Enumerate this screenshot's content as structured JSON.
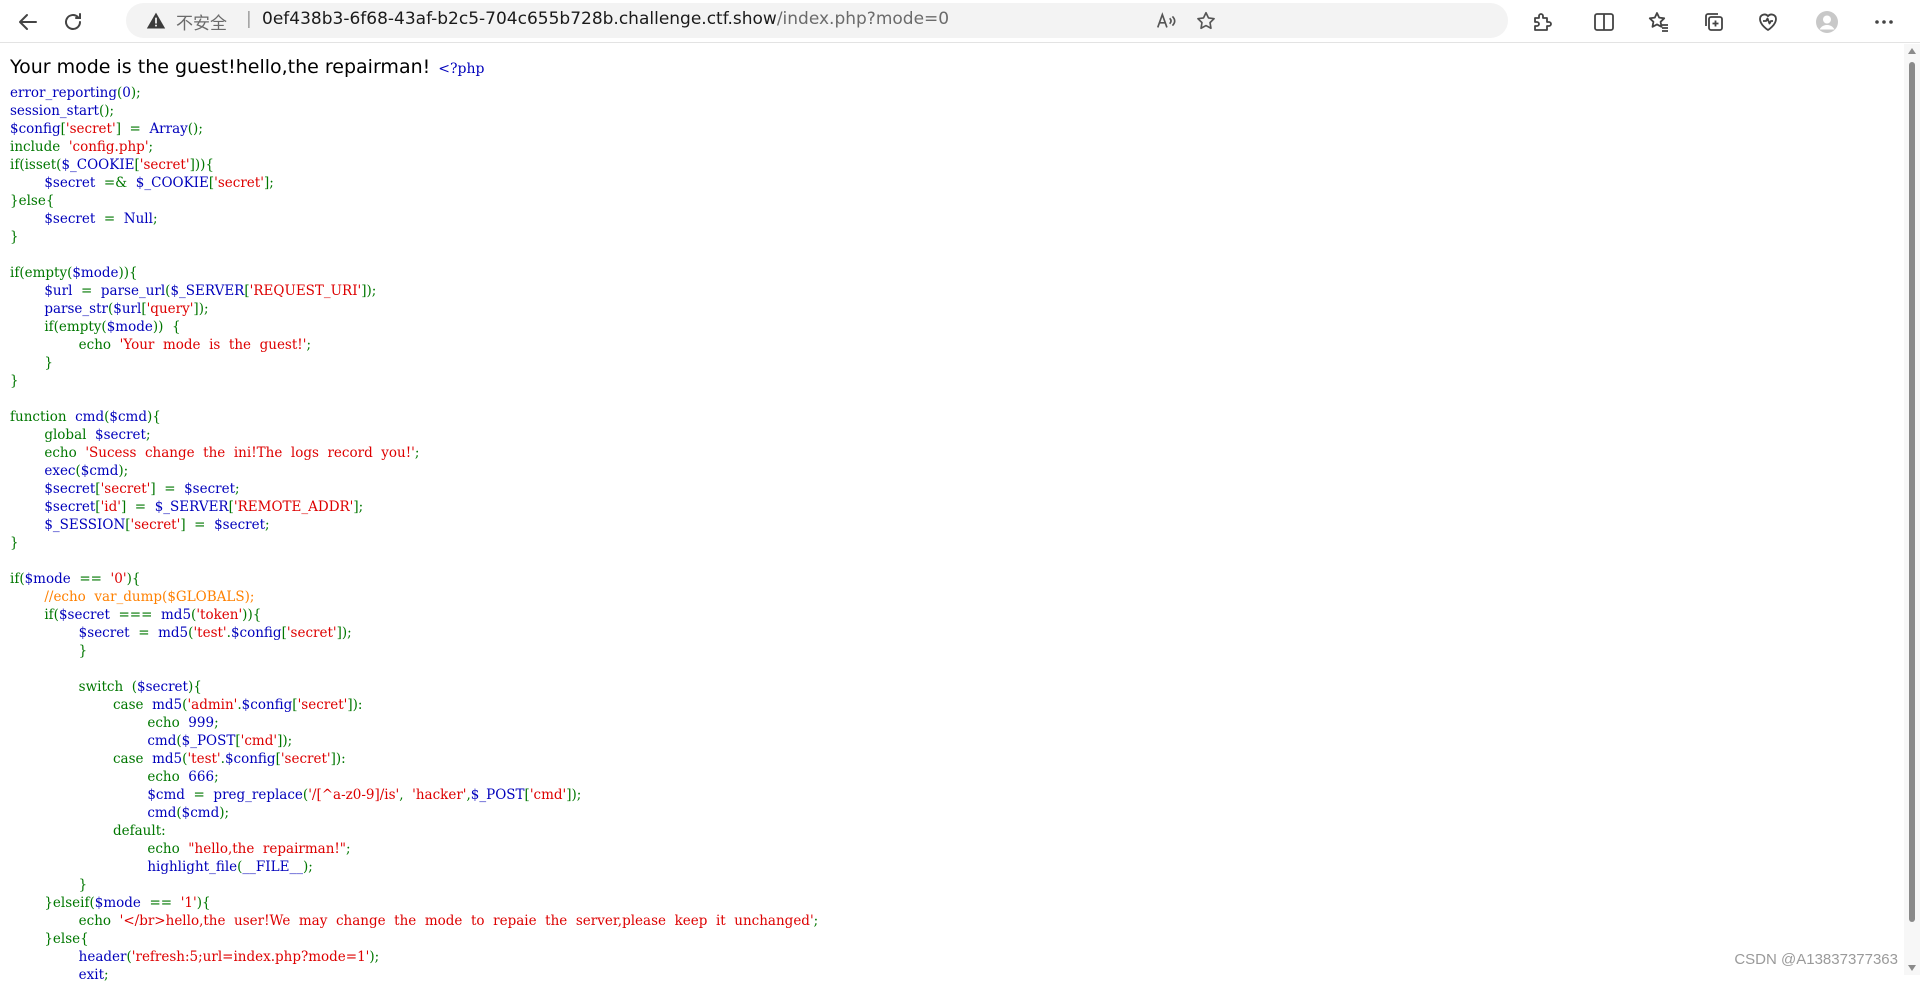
{
  "browser": {
    "security_label": "不安全",
    "separator": "|",
    "url_host": "0ef438b3-6f68-43af-b2c5-704c655b728b.challenge.ctf.show",
    "url_path": "/index.php?mode=0",
    "icons": [
      "back-arrow-icon",
      "reload-icon",
      "warning-icon",
      "read-aloud-icon",
      "favorite-star-icon",
      "extensions-icon",
      "split-screen-icon",
      "favorites-icon",
      "collections-icon",
      "browser-essentials-icon",
      "profile-avatar-icon",
      "more-menu-icon"
    ]
  },
  "page": {
    "greeting": "Your mode is the guest!hello,the repairman!",
    "code_open": "<?php",
    "code_lines": [
      [
        {
          "t": "error_reporting"
        },
        {
          "t": "(",
          "k": "k"
        },
        {
          "t": "0"
        },
        {
          "t": ");",
          "k": "k"
        }
      ],
      [
        {
          "t": "session_start"
        },
        {
          "t": "();",
          "k": "k"
        }
      ],
      [
        {
          "t": "$config"
        },
        {
          "t": "[",
          "k": "k"
        },
        {
          "t": "'secret'",
          "k": "s"
        },
        {
          "t": "]  =  ",
          "k": "k"
        },
        {
          "t": "Array"
        },
        {
          "t": "();",
          "k": "k"
        }
      ],
      [
        {
          "t": "include  ",
          "k": "k"
        },
        {
          "t": "'config.php'",
          "k": "s"
        },
        {
          "t": ";",
          "k": "k"
        }
      ],
      [
        {
          "t": "if(isset(",
          "k": "k"
        },
        {
          "t": "$_COOKIE"
        },
        {
          "t": "[",
          "k": "k"
        },
        {
          "t": "'secret'",
          "k": "s"
        },
        {
          "t": "])){",
          "k": "k"
        }
      ],
      [
        {
          "t": "        "
        },
        {
          "t": "$secret  "
        },
        {
          "t": "=&  ",
          "k": "k"
        },
        {
          "t": "$_COOKIE"
        },
        {
          "t": "[",
          "k": "k"
        },
        {
          "t": "'secret'",
          "k": "s"
        },
        {
          "t": "];",
          "k": "k"
        }
      ],
      [
        {
          "t": "}else{",
          "k": "k"
        }
      ],
      [
        {
          "t": "        "
        },
        {
          "t": "$secret  "
        },
        {
          "t": "=  ",
          "k": "k"
        },
        {
          "t": "Null"
        },
        {
          "t": ";",
          "k": "k"
        }
      ],
      [
        {
          "t": "}",
          "k": "k"
        }
      ],
      [],
      [
        {
          "t": "if(empty(",
          "k": "k"
        },
        {
          "t": "$mode"
        },
        {
          "t": ")){",
          "k": "k"
        }
      ],
      [
        {
          "t": "        "
        },
        {
          "t": "$url  "
        },
        {
          "t": "=  ",
          "k": "k"
        },
        {
          "t": "parse_url"
        },
        {
          "t": "(",
          "k": "k"
        },
        {
          "t": "$_SERVER"
        },
        {
          "t": "[",
          "k": "k"
        },
        {
          "t": "'REQUEST_URI'",
          "k": "s"
        },
        {
          "t": "]);",
          "k": "k"
        }
      ],
      [
        {
          "t": "        "
        },
        {
          "t": "parse_str"
        },
        {
          "t": "(",
          "k": "k"
        },
        {
          "t": "$url"
        },
        {
          "t": "[",
          "k": "k"
        },
        {
          "t": "'query'",
          "k": "s"
        },
        {
          "t": "]);",
          "k": "k"
        }
      ],
      [
        {
          "t": "        "
        },
        {
          "t": "if(empty(",
          "k": "k"
        },
        {
          "t": "$mode"
        },
        {
          "t": "))  {",
          "k": "k"
        }
      ],
      [
        {
          "t": "                "
        },
        {
          "t": "echo  ",
          "k": "k"
        },
        {
          "t": "'Your  mode  is  the  guest!'",
          "k": "s"
        },
        {
          "t": ";",
          "k": "k"
        }
      ],
      [
        {
          "t": "        "
        },
        {
          "t": "}",
          "k": "k"
        }
      ],
      [
        {
          "t": "}",
          "k": "k"
        }
      ],
      [],
      [
        {
          "t": "function  ",
          "k": "k"
        },
        {
          "t": "cmd"
        },
        {
          "t": "(",
          "k": "k"
        },
        {
          "t": "$cmd"
        },
        {
          "t": "){",
          "k": "k"
        }
      ],
      [
        {
          "t": "        "
        },
        {
          "t": "global  ",
          "k": "k"
        },
        {
          "t": "$secret"
        },
        {
          "t": ";",
          "k": "k"
        }
      ],
      [
        {
          "t": "        "
        },
        {
          "t": "echo  ",
          "k": "k"
        },
        {
          "t": "'Sucess  change  the  ini!The  logs  record  you!'",
          "k": "s"
        },
        {
          "t": ";",
          "k": "k"
        }
      ],
      [
        {
          "t": "        "
        },
        {
          "t": "exec"
        },
        {
          "t": "(",
          "k": "k"
        },
        {
          "t": "$cmd"
        },
        {
          "t": ");",
          "k": "k"
        }
      ],
      [
        {
          "t": "        "
        },
        {
          "t": "$secret"
        },
        {
          "t": "[",
          "k": "k"
        },
        {
          "t": "'secret'",
          "k": "s"
        },
        {
          "t": "]  =  ",
          "k": "k"
        },
        {
          "t": "$secret"
        },
        {
          "t": ";",
          "k": "k"
        }
      ],
      [
        {
          "t": "        "
        },
        {
          "t": "$secret"
        },
        {
          "t": "[",
          "k": "k"
        },
        {
          "t": "'id'",
          "k": "s"
        },
        {
          "t": "]  =  ",
          "k": "k"
        },
        {
          "t": "$_SERVER"
        },
        {
          "t": "[",
          "k": "k"
        },
        {
          "t": "'REMOTE_ADDR'",
          "k": "s"
        },
        {
          "t": "];",
          "k": "k"
        }
      ],
      [
        {
          "t": "        "
        },
        {
          "t": "$_SESSION"
        },
        {
          "t": "[",
          "k": "k"
        },
        {
          "t": "'secret'",
          "k": "s"
        },
        {
          "t": "]  =  ",
          "k": "k"
        },
        {
          "t": "$secret"
        },
        {
          "t": ";",
          "k": "k"
        }
      ],
      [
        {
          "t": "}",
          "k": "k"
        }
      ],
      [],
      [
        {
          "t": "if(",
          "k": "k"
        },
        {
          "t": "$mode  "
        },
        {
          "t": "==  ",
          "k": "k"
        },
        {
          "t": "'0'",
          "k": "s"
        },
        {
          "t": "){",
          "k": "k"
        }
      ],
      [
        {
          "t": "        "
        },
        {
          "t": "//echo  var_dump($GLOBALS);",
          "k": "c"
        }
      ],
      [
        {
          "t": "        "
        },
        {
          "t": "if(",
          "k": "k"
        },
        {
          "t": "$secret  "
        },
        {
          "t": "===  ",
          "k": "k"
        },
        {
          "t": "md5"
        },
        {
          "t": "(",
          "k": "k"
        },
        {
          "t": "'token'",
          "k": "s"
        },
        {
          "t": ")){",
          "k": "k"
        }
      ],
      [
        {
          "t": "                "
        },
        {
          "t": "$secret  "
        },
        {
          "t": "=  ",
          "k": "k"
        },
        {
          "t": "md5"
        },
        {
          "t": "(",
          "k": "k"
        },
        {
          "t": "'test'",
          "k": "s"
        },
        {
          "t": ".",
          "k": "k"
        },
        {
          "t": "$config"
        },
        {
          "t": "[",
          "k": "k"
        },
        {
          "t": "'secret'",
          "k": "s"
        },
        {
          "t": "]);",
          "k": "k"
        }
      ],
      [
        {
          "t": "                "
        },
        {
          "t": "}",
          "k": "k"
        }
      ],
      [],
      [
        {
          "t": "                "
        },
        {
          "t": "switch  (",
          "k": "k"
        },
        {
          "t": "$secret"
        },
        {
          "t": "){",
          "k": "k"
        }
      ],
      [
        {
          "t": "                        "
        },
        {
          "t": "case  ",
          "k": "k"
        },
        {
          "t": "md5"
        },
        {
          "t": "(",
          "k": "k"
        },
        {
          "t": "'admin'",
          "k": "s"
        },
        {
          "t": ".",
          "k": "k"
        },
        {
          "t": "$config"
        },
        {
          "t": "[",
          "k": "k"
        },
        {
          "t": "'secret'",
          "k": "s"
        },
        {
          "t": "]):",
          "k": "k"
        }
      ],
      [
        {
          "t": "                                "
        },
        {
          "t": "echo  ",
          "k": "k"
        },
        {
          "t": "999"
        },
        {
          "t": ";",
          "k": "k"
        }
      ],
      [
        {
          "t": "                                "
        },
        {
          "t": "cmd"
        },
        {
          "t": "(",
          "k": "k"
        },
        {
          "t": "$_POST"
        },
        {
          "t": "[",
          "k": "k"
        },
        {
          "t": "'cmd'",
          "k": "s"
        },
        {
          "t": "]);",
          "k": "k"
        }
      ],
      [
        {
          "t": "                        "
        },
        {
          "t": "case  ",
          "k": "k"
        },
        {
          "t": "md5"
        },
        {
          "t": "(",
          "k": "k"
        },
        {
          "t": "'test'",
          "k": "s"
        },
        {
          "t": ".",
          "k": "k"
        },
        {
          "t": "$config"
        },
        {
          "t": "[",
          "k": "k"
        },
        {
          "t": "'secret'",
          "k": "s"
        },
        {
          "t": "]):",
          "k": "k"
        }
      ],
      [
        {
          "t": "                                "
        },
        {
          "t": "echo  ",
          "k": "k"
        },
        {
          "t": "666"
        },
        {
          "t": ";",
          "k": "k"
        }
      ],
      [
        {
          "t": "                                "
        },
        {
          "t": "$cmd  "
        },
        {
          "t": "=  ",
          "k": "k"
        },
        {
          "t": "preg_replace"
        },
        {
          "t": "(",
          "k": "k"
        },
        {
          "t": "'/[^a-z0-9]/is'",
          "k": "s"
        },
        {
          "t": ",  ",
          "k": "k"
        },
        {
          "t": "'hacker'",
          "k": "s"
        },
        {
          "t": ",",
          "k": "k"
        },
        {
          "t": "$_POST"
        },
        {
          "t": "[",
          "k": "k"
        },
        {
          "t": "'cmd'",
          "k": "s"
        },
        {
          "t": "]);",
          "k": "k"
        }
      ],
      [
        {
          "t": "                                "
        },
        {
          "t": "cmd"
        },
        {
          "t": "(",
          "k": "k"
        },
        {
          "t": "$cmd"
        },
        {
          "t": ");",
          "k": "k"
        }
      ],
      [
        {
          "t": "                        "
        },
        {
          "t": "default:",
          "k": "k"
        }
      ],
      [
        {
          "t": "                                "
        },
        {
          "t": "echo  ",
          "k": "k"
        },
        {
          "t": "\"hello,the  repairman!\"",
          "k": "s"
        },
        {
          "t": ";",
          "k": "k"
        }
      ],
      [
        {
          "t": "                                "
        },
        {
          "t": "highlight_file"
        },
        {
          "t": "(",
          "k": "k"
        },
        {
          "t": "__FILE__"
        },
        {
          "t": ");",
          "k": "k"
        }
      ],
      [
        {
          "t": "                "
        },
        {
          "t": "}",
          "k": "k"
        }
      ],
      [
        {
          "t": "        "
        },
        {
          "t": "}elseif(",
          "k": "k"
        },
        {
          "t": "$mode  "
        },
        {
          "t": "==  ",
          "k": "k"
        },
        {
          "t": "'1'",
          "k": "s"
        },
        {
          "t": "){",
          "k": "k"
        }
      ],
      [
        {
          "t": "                "
        },
        {
          "t": "echo  ",
          "k": "k"
        },
        {
          "t": "'</br>hello,the  user!We  may  change  the  mode  to  repaie  the  server,please  keep  it  unchanged'",
          "k": "s"
        },
        {
          "t": ";",
          "k": "k"
        }
      ],
      [
        {
          "t": "        "
        },
        {
          "t": "}else{",
          "k": "k"
        }
      ],
      [
        {
          "t": "                "
        },
        {
          "t": "header"
        },
        {
          "t": "(",
          "k": "k"
        },
        {
          "t": "'refresh:5;url=index.php?mode=1'",
          "k": "s"
        },
        {
          "t": ");",
          "k": "k"
        }
      ],
      [
        {
          "t": "                "
        },
        {
          "t": "exit"
        },
        {
          "t": ";",
          "k": "k"
        }
      ]
    ]
  },
  "watermark": "CSDN @A13837377363",
  "colors": {
    "keyword": "#007700",
    "string": "#dd0000",
    "comment": "#ff8000",
    "default": "#0000bb"
  }
}
